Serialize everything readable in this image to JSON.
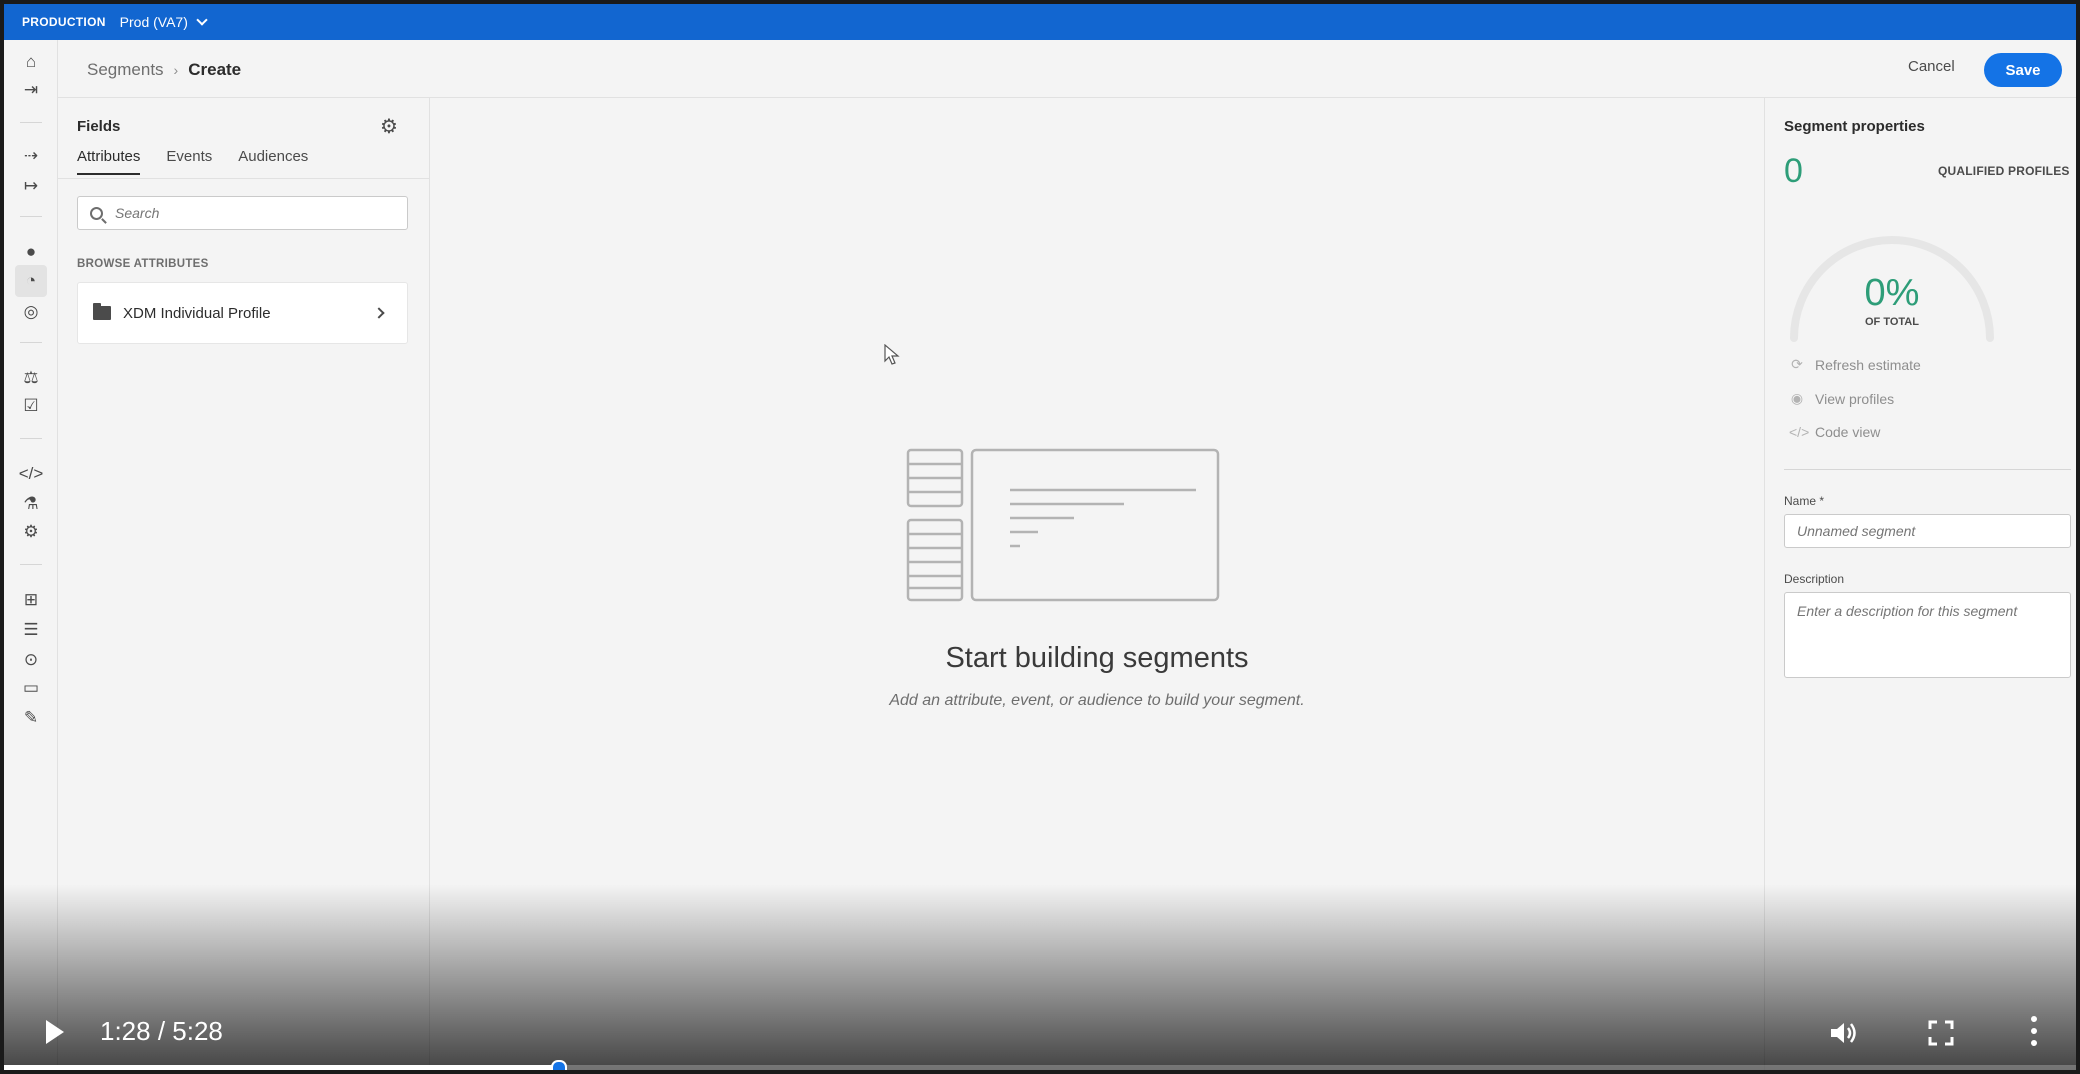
{
  "env": {
    "label": "PRODUCTION",
    "sandbox": "Prod (VA7)"
  },
  "breadcrumb": {
    "parent": "Segments",
    "current": "Create"
  },
  "header": {
    "cancel_label": "Cancel",
    "save_label": "Save"
  },
  "fields": {
    "title": "Fields",
    "tabs": [
      "Attributes",
      "Events",
      "Audiences"
    ],
    "selected_tab": "Attributes",
    "search_placeholder": "Search",
    "browse_label": "BROWSE ATTRIBUTES",
    "items": [
      {
        "label": "XDM Individual Profile"
      }
    ]
  },
  "canvas": {
    "empty_title": "Start building segments",
    "empty_subtitle": "Add an attribute, event, or audience to build your segment."
  },
  "properties": {
    "title": "Segment properties",
    "qualified_count": "0",
    "qualified_label": "QUALIFIED PROFILES",
    "percent": "0%",
    "percent_label": "OF TOTAL",
    "actions": [
      {
        "label": "Refresh estimate",
        "icon": "refresh-icon"
      },
      {
        "label": "View profiles",
        "icon": "eye-icon"
      },
      {
        "label": "Code view",
        "icon": "code-icon"
      }
    ],
    "name_label": "Name *",
    "name_placeholder": "Unnamed segment",
    "description_label": "Description",
    "description_placeholder": "Enter a description for this segment"
  },
  "video": {
    "time": "1:28 / 5:28",
    "progress_fraction": 0.268
  },
  "colors": {
    "env_bar": "#1266d0",
    "primary": "#1473e6",
    "positive": "#2d9d78"
  }
}
